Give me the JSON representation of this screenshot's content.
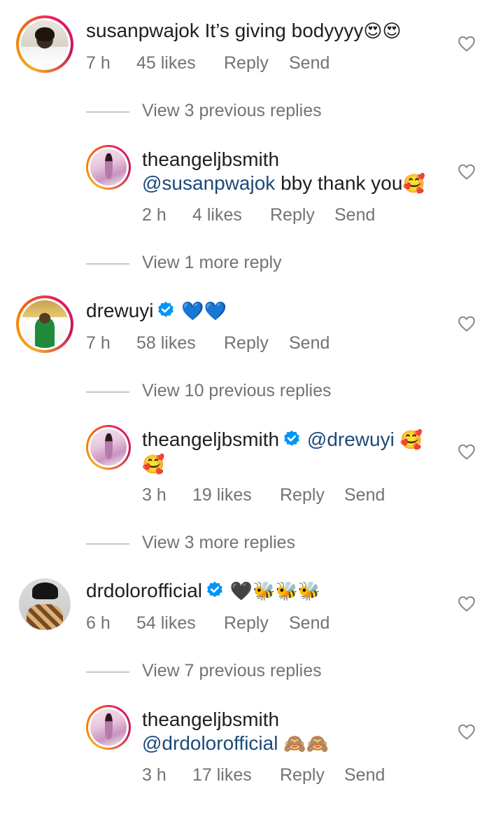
{
  "comments": [
    {
      "username": "susanpwajok",
      "text": "It’s giving bodyyyy",
      "emoji": "😍😍",
      "time": "7 h",
      "likes": "45 likes",
      "reply": "Reply",
      "send": "Send",
      "after": "View 3 previous replies"
    },
    {
      "username": "theangeljbsmith",
      "mention": "@susanpwajok",
      "text": "bby thank you",
      "emoji": "🥰",
      "time": "2 h",
      "likes": "4 likes",
      "reply": "Reply",
      "send": "Send",
      "after": "View 1 more reply"
    },
    {
      "username": "drewuyi",
      "emoji": "💙💙",
      "time": "7 h",
      "likes": "58 likes",
      "reply": "Reply",
      "send": "Send",
      "after": "View 10 previous replies"
    },
    {
      "username": "theangeljbsmith",
      "mention": "@drewuyi",
      "emoji": "🥰",
      "emoji2": "🥰",
      "time": "3 h",
      "likes": "19 likes",
      "reply": "Reply",
      "send": "Send",
      "after": "View 3 more replies"
    },
    {
      "username": "drdolorofficial",
      "emoji": "🖤🐝🐝🐝",
      "time": "6 h",
      "likes": "54 likes",
      "reply": "Reply",
      "send": "Send",
      "after": "View 7 previous replies"
    },
    {
      "username": "theangeljbsmith",
      "mention": "@drdolorofficial",
      "emoji": "🙈🙈",
      "time": "3 h",
      "likes": "17 likes",
      "reply": "Reply",
      "send": "Send"
    }
  ],
  "colors": {
    "mention": "#1c4a7a",
    "meta": "#737373",
    "verified": "#0095f6"
  },
  "icons": {
    "like": "heart-outline-icon",
    "verified": "verified-badge-icon"
  }
}
